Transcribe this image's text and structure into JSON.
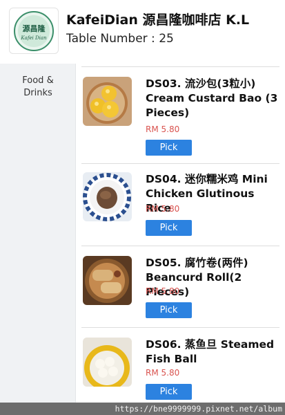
{
  "header": {
    "logo_icon": "store-logo-icon",
    "logo_text": "源昌隆",
    "logo_subtext": "Kafei Dian",
    "title": "KafeiDian 源昌隆咖啡店 K.L",
    "table_number": "Table Number : 25"
  },
  "sidebar": {
    "items": [
      {
        "label": "Food & Drinks"
      }
    ]
  },
  "menu": {
    "price_color": "#d9534f",
    "button_color": "#2c82e0",
    "items": [
      {
        "name": "DS03. 流沙包(3粒小) Cream Custard Bao (3 Pieces)",
        "price": "RM 5.80",
        "button": "Pick",
        "image_icon": "custard-bao-photo"
      },
      {
        "name": "DS04. 迷你糯米鸡 Mini Chicken Glutinous Rice",
        "price": "RM 5.80",
        "button": "Pick",
        "image_icon": "glutinous-rice-photo"
      },
      {
        "name": "DS05. 腐竹卷(两件) Beancurd Roll(2 Pieces)",
        "price": "RM 5.80",
        "button": "Pick",
        "image_icon": "beancurd-roll-photo"
      },
      {
        "name": "DS06. 蒸鱼旦 Steamed Fish Ball",
        "price": "RM 5.80",
        "button": "Pick",
        "image_icon": "fish-ball-photo"
      }
    ]
  },
  "watermark": "https://bne9999999.pixnet.net/album"
}
